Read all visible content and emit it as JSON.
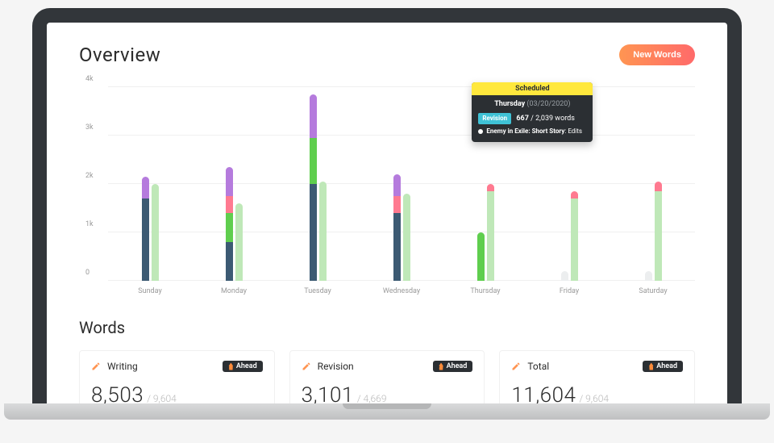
{
  "header": {
    "title": "Overview",
    "new_words_btn": "New Words"
  },
  "chart_data": {
    "type": "bar",
    "categories": [
      "Sunday",
      "Monday",
      "Tuesday",
      "Wednesday",
      "Thursday",
      "Friday",
      "Saturday"
    ],
    "ylim": [
      0,
      4000
    ],
    "yticks": [
      0,
      1000,
      2000,
      3000,
      4000
    ],
    "ytick_labels": [
      "0",
      "1k",
      "2k",
      "3k",
      "4k"
    ],
    "series_colors": {
      "writing": "#3c5a73",
      "revision_green": "#5fce4e",
      "revision_pink": "#ff7a90",
      "other_purple": "#b57bdd",
      "ghost": "#eceeef",
      "light_green": "#bfe8b8"
    },
    "days": [
      {
        "name": "Sunday",
        "bars": [
          {
            "total": 2150,
            "segments": [
              {
                "color": "#3c5a73",
                "value": 1700
              },
              {
                "color": "#b57bdd",
                "value": 450
              }
            ]
          },
          {
            "color": "#bfe8b8",
            "value": 2000
          }
        ]
      },
      {
        "name": "Monday",
        "bars": [
          {
            "total": 2350,
            "segments": [
              {
                "color": "#3c5a73",
                "value": 800
              },
              {
                "color": "#5fce4e",
                "value": 600
              },
              {
                "color": "#ff7a90",
                "value": 350
              },
              {
                "color": "#b57bdd",
                "value": 600
              }
            ]
          },
          {
            "color": "#bfe8b8",
            "value": 1600
          }
        ]
      },
      {
        "name": "Tuesday",
        "bars": [
          {
            "total": 3850,
            "segments": [
              {
                "color": "#3c5a73",
                "value": 2000
              },
              {
                "color": "#5fce4e",
                "value": 950
              },
              {
                "color": "#b57bdd",
                "value": 900
              }
            ]
          },
          {
            "color": "#bfe8b8",
            "value": 2050
          }
        ]
      },
      {
        "name": "Wednesday",
        "bars": [
          {
            "total": 2200,
            "segments": [
              {
                "color": "#3c5a73",
                "value": 1400
              },
              {
                "color": "#ff7a90",
                "value": 350
              },
              {
                "color": "#b57bdd",
                "value": 450
              }
            ]
          },
          {
            "color": "#bfe8b8",
            "value": 1800
          }
        ]
      },
      {
        "name": "Thursday",
        "bars": [
          {
            "color": "#5fce4e",
            "value": 1000
          },
          {
            "total": 2000,
            "segments": [
              {
                "color": "#bfe8b8",
                "value": 1850
              },
              {
                "color": "#ff7a90",
                "value": 150
              }
            ]
          }
        ]
      },
      {
        "name": "Friday",
        "bars": [
          {
            "color": "#eceeef",
            "value": 200
          },
          {
            "total": 1850,
            "segments": [
              {
                "color": "#bfe8b8",
                "value": 1700
              },
              {
                "color": "#ff7a90",
                "value": 150
              }
            ]
          }
        ]
      },
      {
        "name": "Saturday",
        "bars": [
          {
            "color": "#eceeef",
            "value": 200
          },
          {
            "total": 2050,
            "segments": [
              {
                "color": "#bfe8b8",
                "value": 1850
              },
              {
                "color": "#ff7a90",
                "value": 200
              }
            ]
          }
        ]
      }
    ],
    "tooltip": {
      "header": "Scheduled",
      "day": "Thursday",
      "date": "(03/20/2020)",
      "tag": "Revision",
      "value": "667",
      "target": "/ 2,039 words",
      "project": "Enemy in Exile: Short Story",
      "suffix": ": Edits"
    }
  },
  "words": {
    "title": "Words",
    "cards": [
      {
        "label": "Writing",
        "icon_color": "#ff9552",
        "badge": "Ahead",
        "value": "8,503",
        "target": "/ 9,604"
      },
      {
        "label": "Revision",
        "icon_color": "#ff9552",
        "badge": "Ahead",
        "value": "3,101",
        "target": "/ 4,669"
      },
      {
        "label": "Total",
        "icon_color": "#ff9552",
        "badge": "Ahead",
        "value": "11,604",
        "target": "/ 9,604"
      }
    ]
  }
}
